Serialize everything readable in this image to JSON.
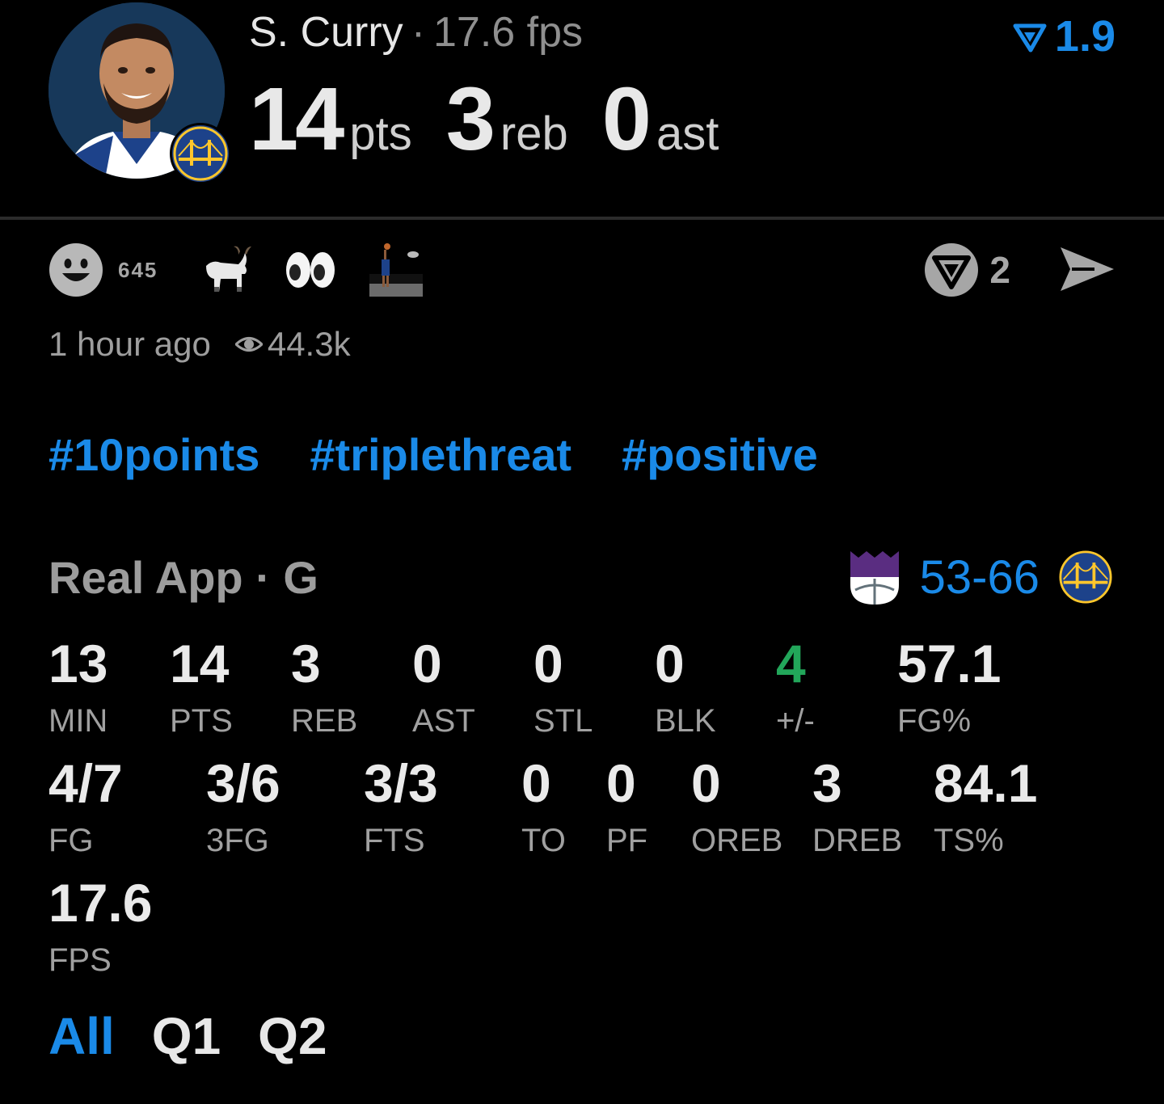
{
  "header": {
    "player_name": "S. Curry",
    "separator": "·",
    "fps_label": "17.6 fps",
    "points": "14",
    "points_unit": "pts",
    "rebounds": "3",
    "rebounds_unit": "reb",
    "assists": "0",
    "assists_unit": "ast",
    "boost_value": "1.9",
    "avatar_icon": "player-photo",
    "team_icon": "golden-state-warriors-logo"
  },
  "reactions": {
    "count": "645",
    "icons": [
      "smiley-icon",
      "goat-emoji",
      "eyes-emoji",
      "shooting-photo-emoji"
    ],
    "comment_count": "2",
    "comment_icon": "comment-logo-icon",
    "share_icon": "share-arrow-icon"
  },
  "meta": {
    "time_ago": "1 hour ago",
    "views": "44.3k"
  },
  "tags": [
    "#10points",
    "#triplethreat",
    "#positive"
  ],
  "game": {
    "title": "Real App · G",
    "score": "53-66",
    "away_team_icon": "sacramento-kings-logo",
    "home_team_icon": "golden-state-warriors-logo"
  },
  "stats": {
    "row1": [
      {
        "value": "13",
        "label": "MIN"
      },
      {
        "value": "14",
        "label": "PTS"
      },
      {
        "value": "3",
        "label": "REB"
      },
      {
        "value": "0",
        "label": "AST"
      },
      {
        "value": "0",
        "label": "STL"
      },
      {
        "value": "0",
        "label": "BLK"
      },
      {
        "value": "4",
        "label": "+/-"
      },
      {
        "value": "57.1",
        "label": "FG%"
      }
    ],
    "row2": [
      {
        "value": "4/7",
        "label": "FG"
      },
      {
        "value": "3/6",
        "label": "3FG"
      },
      {
        "value": "3/3",
        "label": "FTS"
      },
      {
        "value": "0",
        "label": "TO"
      },
      {
        "value": "0",
        "label": "PF"
      },
      {
        "value": "0",
        "label": "OREB"
      },
      {
        "value": "3",
        "label": "DREB"
      },
      {
        "value": "84.1",
        "label": "TS%"
      }
    ],
    "row3": [
      {
        "value": "17.6",
        "label": "FPS"
      }
    ]
  },
  "tabs": [
    {
      "label": "All",
      "active": true
    },
    {
      "label": "Q1",
      "active": false
    },
    {
      "label": "Q2",
      "active": false
    }
  ],
  "colors": {
    "accent_blue": "#1a8ae8",
    "positive_green": "#22a65a",
    "background": "#000000"
  }
}
